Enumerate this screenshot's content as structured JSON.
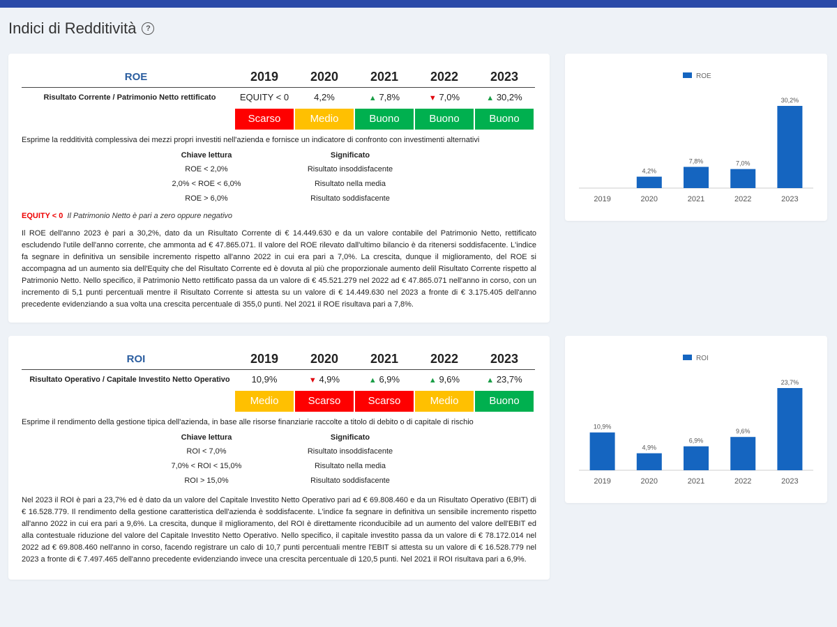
{
  "page": {
    "title": "Indici di Redditività",
    "help_icon": "?"
  },
  "colors": {
    "topbar": "#2a4aa8",
    "kpi_name": "#2a5d9f",
    "scarso": "#fe0000",
    "medio": "#ffc001",
    "buono": "#00b04f",
    "bar": "#1565c0"
  },
  "years": [
    "2019",
    "2020",
    "2021",
    "2022",
    "2023"
  ],
  "roe": {
    "name": "ROE",
    "formula": "Risultato Corrente / Patrimonio Netto rettificato",
    "values": [
      {
        "arrow": "",
        "text": "EQUITY < 0"
      },
      {
        "arrow": "",
        "text": "4,2%"
      },
      {
        "arrow": "▲",
        "text": "7,8%"
      },
      {
        "arrow": "▼",
        "text": "7,0%"
      },
      {
        "arrow": "▲",
        "text": "30,2%"
      }
    ],
    "ratings": [
      "Scarso",
      "Medio",
      "Buono",
      "Buono",
      "Buono"
    ],
    "description": "Esprime la redditività complessiva dei mezzi propri investiti nell'azienda e fornisce un indicatore di confronto con investimenti alternativi",
    "key_header": "Chiave lettura",
    "meaning_header": "Significato",
    "keys": [
      {
        "key": "ROE < 2,0%",
        "meaning": "Risultato insoddisfacente"
      },
      {
        "key": "2,0% < ROE < 6,0%",
        "meaning": "Risultato nella media"
      },
      {
        "key": "ROE > 6,0%",
        "meaning": "Risultato soddisfacente"
      }
    ],
    "note_label": "EQUITY < 0",
    "note_text": "Il Patrimonio Netto è pari a zero oppure negativo",
    "paragraph": "Il ROE dell'anno 2023 è pari a 30,2%, dato da un Risultato Corrente di € 14.449.630 e da un valore contabile del Patrimonio Netto, rettificato escludendo l'utile dell'anno corrente, che ammonta ad € 47.865.071. Il valore del ROE rilevato dall'ultimo bilancio è da ritenersi soddisfacente. L'indice fa segnare in definitiva un sensibile incremento rispetto all'anno 2022 in cui era pari a 7,0%. La crescita, dunque il miglioramento, del ROE si accompagna ad un aumento sia dell'Equity che del Risultato Corrente ed è dovuta al più che proporzionale aumento delil Risultato Corrente rispetto al Patrimonio Netto. Nello specifico, il Patrimonio Netto rettificato passa da un valore di € 45.521.279 nel 2022 ad € 47.865.071 nell'anno in corso, con un incremento di 5,1 punti percentuali mentre il Risultato Corrente si attesta su un valore di € 14.449.630 nel 2023 a fronte di € 3.175.405 dell'anno precedente evidenziando a sua volta una crescita percentuale di 355,0 punti. Nel 2021 il ROE risultava pari a 7,8%."
  },
  "roi": {
    "name": "ROI",
    "formula": "Risultato Operativo / Capitale Investito Netto Operativo",
    "values": [
      {
        "arrow": "",
        "text": "10,9%"
      },
      {
        "arrow": "▼",
        "text": "4,9%"
      },
      {
        "arrow": "▲",
        "text": "6,9%"
      },
      {
        "arrow": "▲",
        "text": "9,6%"
      },
      {
        "arrow": "▲",
        "text": "23,7%"
      }
    ],
    "ratings": [
      "Medio",
      "Scarso",
      "Scarso",
      "Medio",
      "Buono"
    ],
    "description": "Esprime il rendimento della gestione tipica dell'azienda, in base alle risorse finanziarie raccolte a titolo di debito o di capitale di rischio",
    "key_header": "Chiave lettura",
    "meaning_header": "Significato",
    "keys": [
      {
        "key": "ROI < 7,0%",
        "meaning": "Risultato insoddisfacente"
      },
      {
        "key": "7,0% < ROI < 15,0%",
        "meaning": "Risultato nella media"
      },
      {
        "key": "ROI > 15,0%",
        "meaning": "Risultato soddisfacente"
      }
    ],
    "paragraph": "Nel 2023 il ROI è pari a 23,7% ed è dato da un valore del Capitale Investito Netto Operativo pari ad € 69.808.460 e da un Risultato Operativo (EBIT) di € 16.528.779. Il rendimento della gestione caratteristica dell'azienda è soddisfacente. L'indice fa segnare in definitiva un sensibile incremento rispetto all'anno 2022 in cui era pari a 9,6%. La crescita, dunque il miglioramento, del ROI è direttamente riconducibile ad un aumento del valore dell'EBIT ed alla contestuale riduzione del valore del Capitale Investito Netto Operativo. Nello specifico, il capitale investito passa da un valore di € 78.172.014 nel 2022 ad € 69.808.460 nell'anno in corso, facendo registrare un calo di 10,7 punti percentuali mentre l'EBIT si attesta su un valore di € 16.528.779 nel 2023 a fronte di € 7.497.465 dell'anno precedente evidenziando invece una crescita percentuale di 120,5 punti. Nel 2021 il ROI risultava pari a 6,9%."
  },
  "chart_data": [
    {
      "type": "bar",
      "legend": "top",
      "grid": false,
      "categories": [
        "2019",
        "2020",
        "2021",
        "2022",
        "2023"
      ],
      "series": [
        {
          "name": "ROE",
          "values": [
            null,
            4.2,
            7.8,
            7.0,
            30.2
          ]
        }
      ],
      "labels": [
        "",
        "4,2%",
        "7,8%",
        "7,0%",
        "30,2%"
      ],
      "ylim": [
        0,
        30.2
      ]
    },
    {
      "type": "bar",
      "legend": "top",
      "grid": false,
      "categories": [
        "2019",
        "2020",
        "2021",
        "2022",
        "2023"
      ],
      "series": [
        {
          "name": "ROI",
          "values": [
            10.9,
            4.9,
            6.9,
            9.6,
            23.7
          ]
        }
      ],
      "labels": [
        "10,9%",
        "4,9%",
        "6,9%",
        "9,6%",
        "23,7%"
      ],
      "ylim": [
        0,
        23.7
      ]
    }
  ]
}
